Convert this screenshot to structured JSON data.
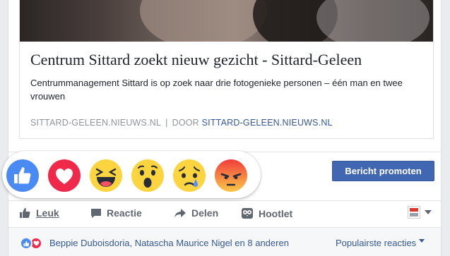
{
  "preview": {
    "title": "Centrum Sittard zoekt nieuw gezicht - Sittard-Geleen",
    "description": "Centrummanagement Sittard is op zoek naar drie fotogenieke personen – één man en twee vrouwen",
    "domain": "SITTARD-GELEEN.NIEUWS.NL",
    "separator": "|",
    "by_label": "DOOR",
    "author": "SITTARD-GELEEN.NIEUWS.NL"
  },
  "promote": {
    "label": "Bericht promoten",
    "color": "#4267b2"
  },
  "actions": {
    "like": "Leuk",
    "comment": "Reactie",
    "share": "Delen",
    "hootlet": "Hootlet"
  },
  "summary": {
    "names": "Beppie Duboisdoria, Natascha Maurice Nigel en 8 anderen",
    "top_reactions": "Populairste reacties"
  },
  "reactions": [
    {
      "name": "like",
      "icon": "thumbs-up-icon",
      "color": "#4a8af4"
    },
    {
      "name": "love",
      "icon": "heart-icon",
      "color": "#f0284a"
    },
    {
      "name": "haha",
      "icon": "laughing-face-icon",
      "color": "#fcd440"
    },
    {
      "name": "wow",
      "icon": "surprised-face-icon",
      "color": "#fcd440"
    },
    {
      "name": "sad",
      "icon": "sad-face-icon",
      "color": "#fcd440"
    },
    {
      "name": "angry",
      "icon": "angry-face-icon",
      "color": "#f05a35"
    }
  ]
}
